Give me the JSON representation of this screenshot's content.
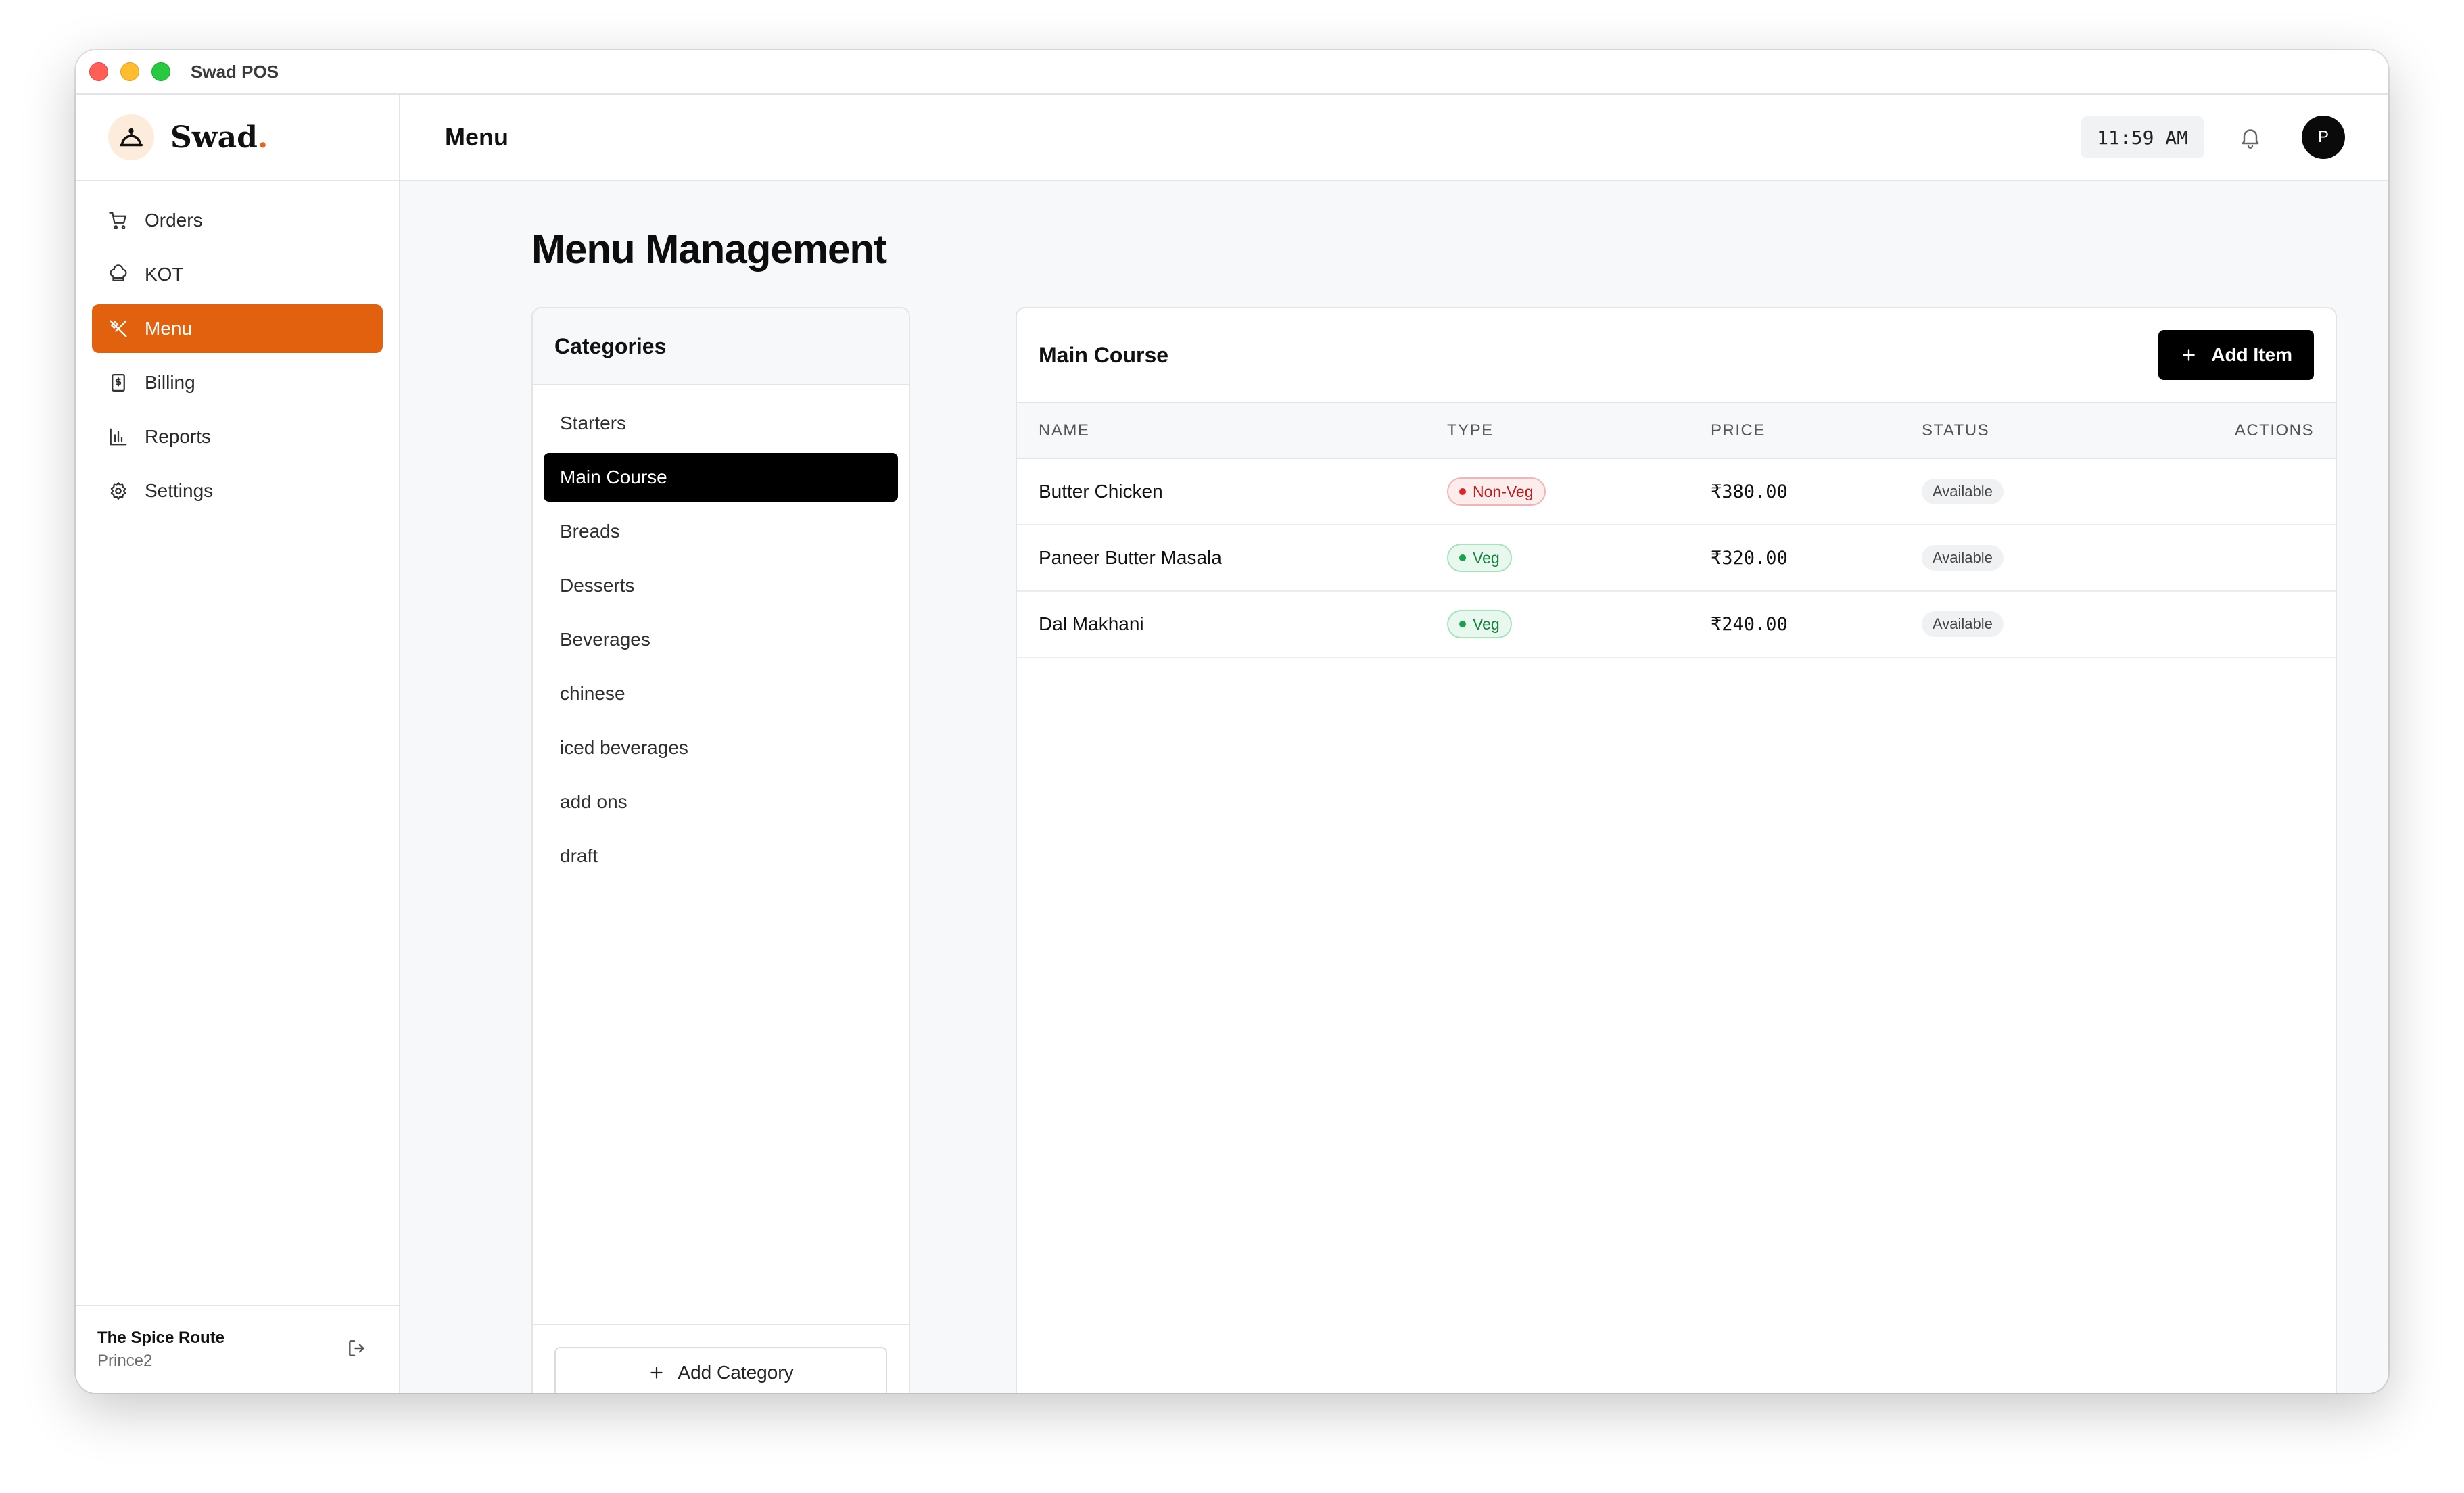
{
  "window": {
    "title": "Swad POS"
  },
  "brand": {
    "name": "Swad",
    "dot": "."
  },
  "sidebar": {
    "items": [
      {
        "label": "Orders",
        "icon": "cart-icon",
        "active": false
      },
      {
        "label": "KOT",
        "icon": "chef-hat-icon",
        "active": false
      },
      {
        "label": "Menu",
        "icon": "utensils-icon",
        "active": true
      },
      {
        "label": "Billing",
        "icon": "receipt-icon",
        "active": false
      },
      {
        "label": "Reports",
        "icon": "bar-chart-icon",
        "active": false
      },
      {
        "label": "Settings",
        "icon": "gear-icon",
        "active": false
      }
    ],
    "footer": {
      "restaurant": "The Spice Route",
      "user": "Prince2"
    }
  },
  "header": {
    "title": "Menu",
    "time": "11:59 AM",
    "avatar_initial": "P"
  },
  "page": {
    "title": "Menu Management"
  },
  "categories": {
    "title": "Categories",
    "items": [
      "Starters",
      "Main Course",
      "Breads",
      "Desserts",
      "Beverages",
      "chinese",
      "iced beverages",
      "add ons",
      "draft"
    ],
    "selected": "Main Course",
    "add_label": "Add Category"
  },
  "items_panel": {
    "title": "Main Course",
    "add_label": "Add Item",
    "columns": [
      "NAME",
      "TYPE",
      "PRICE",
      "STATUS",
      "ACTIONS"
    ],
    "rows": [
      {
        "name": "Butter Chicken",
        "type": "Non-Veg",
        "price": "₹380.00",
        "status": "Available"
      },
      {
        "name": "Paneer Butter Masala",
        "type": "Veg",
        "price": "₹320.00",
        "status": "Available"
      },
      {
        "name": "Dal Makhani",
        "type": "Veg",
        "price": "₹240.00",
        "status": "Available"
      }
    ]
  },
  "colors": {
    "accent": "#e2610f",
    "selected_category": "#000000",
    "non_veg": "#dc2626",
    "veg": "#16a34a"
  }
}
